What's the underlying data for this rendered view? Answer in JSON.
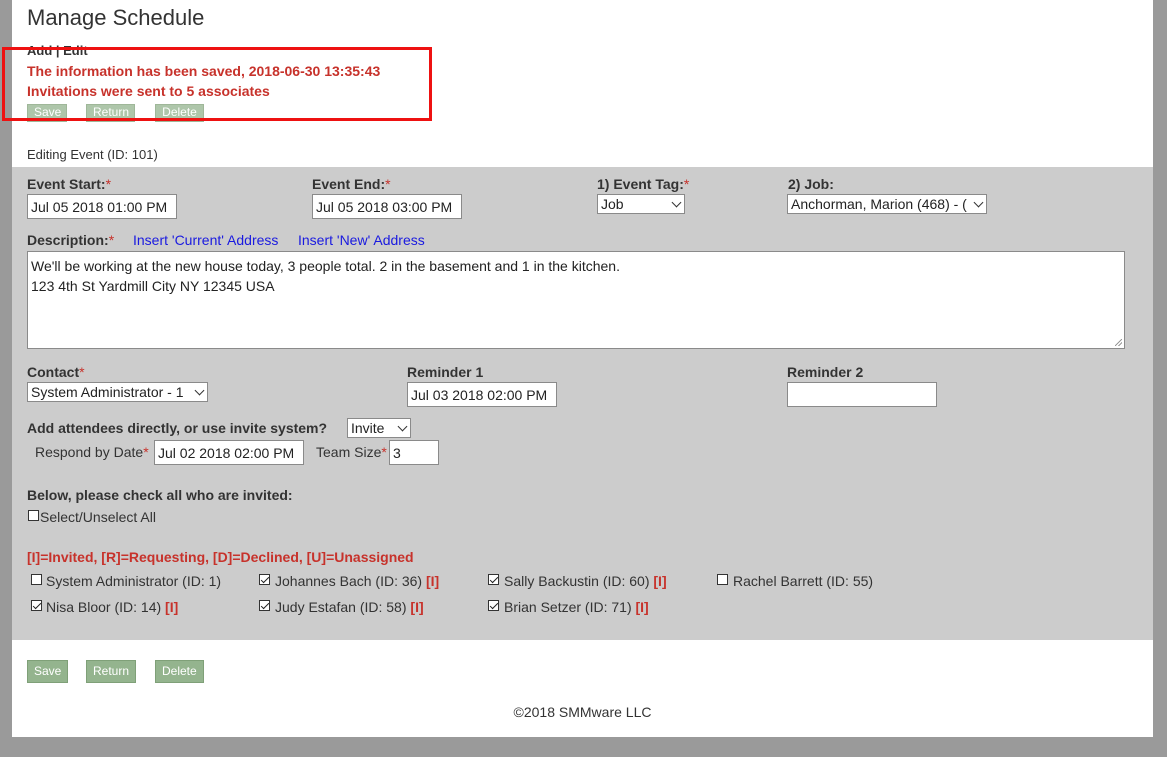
{
  "page_title": "Manage Schedule",
  "add_edit": "Add | Edit",
  "messages": {
    "saved": "The information has been saved, 2018-06-30 13:35:43",
    "invitations": "Invitations were sent to 5 associates"
  },
  "buttons": {
    "save": "Save",
    "return": "Return",
    "delete": "Delete"
  },
  "editing_label": "Editing Event (ID: 101)",
  "form": {
    "event_start_label": "Event Start:",
    "event_start_value": "Jul 05 2018 01:00 PM",
    "event_end_label": "Event End:",
    "event_end_value": "Jul 05 2018 03:00 PM",
    "event_tag_label": "1) Event Tag:",
    "event_tag_value": "Job",
    "job_label": "2) Job:",
    "job_value": "Anchorman, Marion (468) - (",
    "description_label": "Description:",
    "insert_current": "Insert 'Current' Address",
    "insert_new": "Insert 'New' Address",
    "description_line1": "We'll be working at the new house today, 3 people total. 2 in the basement and 1 in the kitchen.",
    "description_line2": "123 4th St  Yardmill City NY 12345 USA",
    "contact_label": "Contact",
    "contact_value": "System Administrator - 1",
    "reminder1_label": "Reminder 1",
    "reminder1_value": "Jul 03 2018 02:00 PM",
    "reminder2_label": "Reminder 2",
    "reminder2_value": "",
    "attendees_label": "Add attendees directly, or use invite system?",
    "attendees_mode": "Invite",
    "respond_by_label": "Respond by Date",
    "respond_by_value": "Jul 02 2018 02:00 PM",
    "team_size_label": "Team Size",
    "team_size_value": "3",
    "invite_heading": "Below, please check all who are invited:",
    "select_all_label": "Select/Unselect All",
    "legend": "[I]=Invited, [R]=Requesting, [D]=Declined, [U]=Unassigned",
    "required_mark": "*"
  },
  "associates": [
    {
      "name": "System Administrator (ID: 1)",
      "checked": false,
      "tag": ""
    },
    {
      "name": "Johannes Bach (ID: 36)",
      "checked": true,
      "tag": "[I]"
    },
    {
      "name": "Sally Backustin (ID: 60)",
      "checked": true,
      "tag": "[I]"
    },
    {
      "name": "Rachel Barrett (ID: 55)",
      "checked": false,
      "tag": ""
    },
    {
      "name": "Nisa Bloor (ID: 14)",
      "checked": true,
      "tag": "[I]"
    },
    {
      "name": "Judy Estafan (ID: 58)",
      "checked": true,
      "tag": "[I]"
    },
    {
      "name": "Brian Setzer (ID: 71)",
      "checked": true,
      "tag": "[I]"
    }
  ],
  "footer": "©2018 SMMware LLC"
}
